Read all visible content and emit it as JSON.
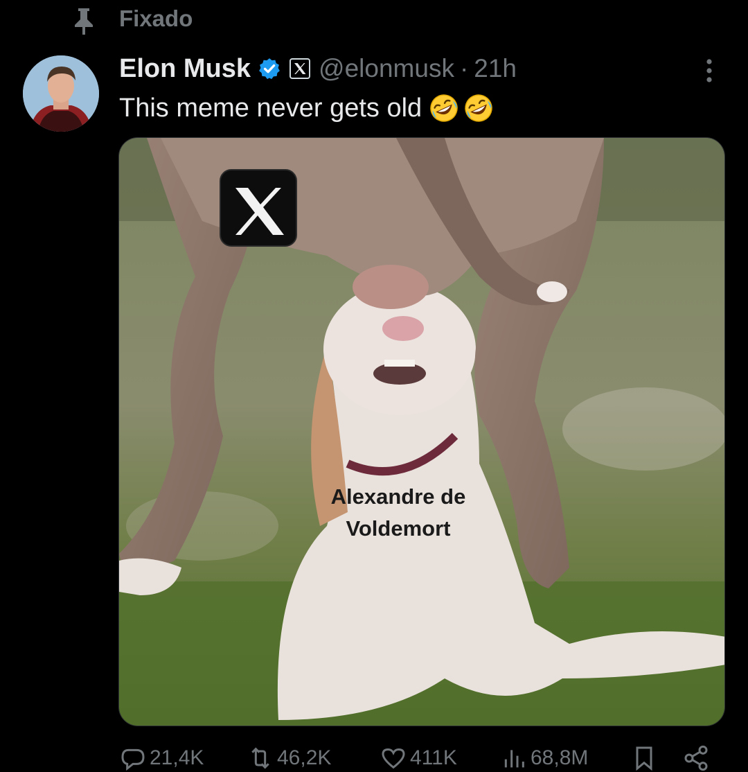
{
  "pinned": {
    "label": "Fixado",
    "icon": "pin-icon"
  },
  "author": {
    "display_name": "Elon Musk",
    "handle": "@elonmusk",
    "separator": "·",
    "time": "21h",
    "verified_color": "#1d9bf0",
    "badge_icon": "x-affiliate-badge-icon"
  },
  "tweet": {
    "text": "This meme never gets old",
    "emoji": "rolling-on-floor-laughing-emoji"
  },
  "media": {
    "overlay_logo": "x-logo-icon",
    "caption_line1": "Alexandre de",
    "caption_line2": "Voldemort"
  },
  "actions": {
    "replies": "21,4K",
    "reposts": "46,2K",
    "likes": "411K",
    "views": "68,8M"
  },
  "colors": {
    "background": "#000000",
    "text_primary": "#e7e9ea",
    "text_secondary": "#71767b",
    "verified": "#1d9bf0"
  }
}
